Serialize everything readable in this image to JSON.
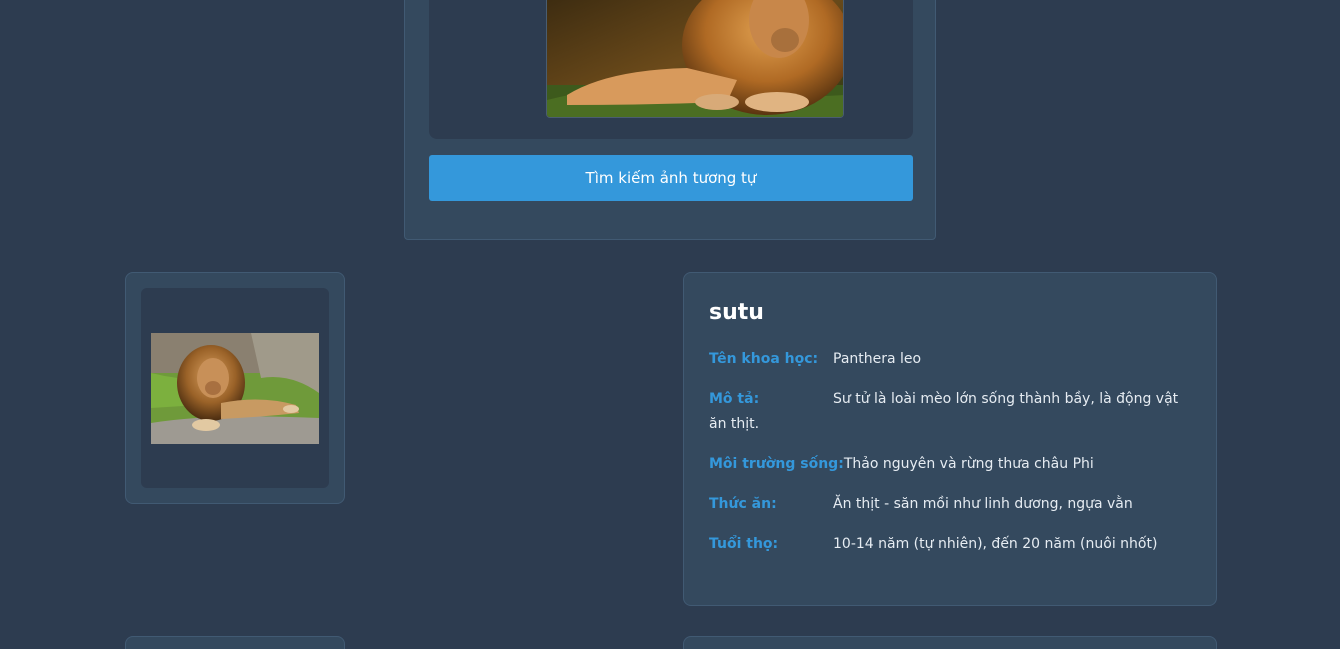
{
  "search": {
    "button_label": "Tìm kiếm ảnh tương tự"
  },
  "result": {
    "name": "sutu",
    "fields": [
      {
        "label": "Tên khoa học:",
        "value": "Panthera leo"
      },
      {
        "label": "Mô tả:",
        "value": "Sư tử là loài mèo lớn sống thành bầy, là động vật ăn thịt."
      },
      {
        "label": "Môi trường sống:",
        "value": "Thảo nguyên và rừng thưa châu Phi"
      },
      {
        "label": "Thức ăn:",
        "value": "Ăn thịt - săn mồi như linh dương, ngựa vằn"
      },
      {
        "label": "Tuổi thọ:",
        "value": "10-14 năm (tự nhiên), đến 20 năm (nuôi nhốt)"
      }
    ]
  },
  "colors": {
    "background": "#2d3c50",
    "card": "#34495e",
    "accent": "#3498db"
  }
}
